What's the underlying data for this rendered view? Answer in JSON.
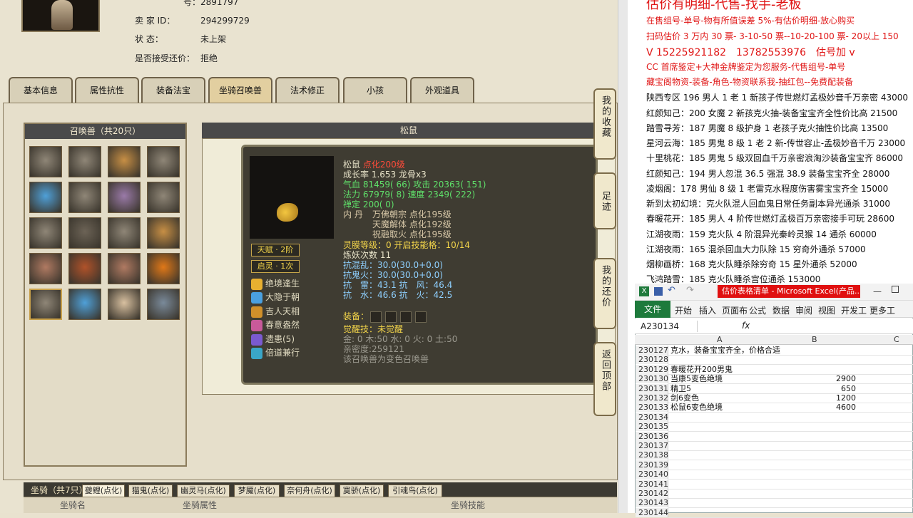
{
  "game": {
    "header": {
      "id_partial": "号：2891797",
      "seller_label": "卖 家 ID：",
      "seller_id": "294299729",
      "status_label": "状 态：",
      "status_value": "未上架",
      "bargain_label": "是否接受还价：",
      "bargain_value": "拒绝"
    },
    "tabs": [
      "基本信息",
      "属性抗性",
      "装备法宝",
      "坐骑召唤兽",
      "法术修正",
      "小孩",
      "外观道具"
    ],
    "active_tab": "坐骑召唤兽",
    "pet_panel_title": "召唤兽（共20只）",
    "detail_title": "松鼠",
    "pet": {
      "name": "松鼠",
      "dianhua": "点化200级",
      "growth": "成长率 1.653 龙骨x3",
      "hp_label": "气血",
      "hp": "81459( 66)",
      "atk_label": "攻击",
      "atk": "20363( 151)",
      "mp_label": "法力",
      "mp": "67979( 8)",
      "spd_label": "速度",
      "spd": "2349( 222)",
      "chan": "禅定 200( 0)",
      "neidan_label": "内 丹",
      "neidan": [
        "万佛朝宗 点化195级",
        "天魔解体 点化192级",
        "祝融取火 点化195级"
      ],
      "spirit": "灵膜等级：0 开启技能格：10/14",
      "refine": "炼妖次数 11",
      "res1": "抗混乱：30.0(30.0+0.0)",
      "res2": "抗鬼火：30.0(30.0+0.0)",
      "res3": "抗　雷：43.1 抗　风：46.4",
      "res4": "抗　水：46.6 抗　火：42.5",
      "equip_label": "装备：",
      "awaken": "觉醒技：未觉醒",
      "elements": "金: 0 木:50 水: 0 火: 0 土:50",
      "intimacy": "亲密度:259121",
      "note": "该召唤兽为变色召唤兽",
      "badges": [
        "天赋 · 2阶",
        "启灵 · 1次"
      ],
      "skills": [
        "绝境逢生",
        "大隐于朝",
        "吉人天相",
        "春意盎然",
        "遗患(5)",
        "倍道兼行"
      ]
    },
    "side_nav": [
      "我的收藏",
      "足迹",
      "我的还价",
      "返回顶部"
    ],
    "mount_label": "坐骑（共7只）",
    "mount_tabs": [
      "夔鲤(点化)",
      "猫鬼(点化)",
      "幽灵马(点化)",
      "梦魇(点化)",
      "奈何舟(点化)",
      "寞骄(点化)",
      "引魂鸟(点化)"
    ],
    "mount_headers": [
      "坐骑名",
      "坐骑属性",
      "坐骑技能"
    ]
  },
  "right_panel": {
    "title_partial": "估价有明细-代售-找手-老板",
    "red_lines": [
      "在售组号-单号-物有所值误差 5%-有估价明细-放心购买",
      "扫码估价 3 万内 30 票- 3-10-50 票--10-20-100 票- 20以上 150",
      "V 15225921182　13782553976　估号加 v",
      "CC 首席鉴定+大神金牌鉴定为您服务-代售组号-单号",
      "藏宝阁物资-装备-角色-物资联系我-抽红包--免费配装备"
    ],
    "listings": [
      "陕西专区 196 男人 1 老 1 新孩子传世燃灯孟极妙音千万亲密 43000",
      "红颜知己：200 女魔 2 新孩克火抽-装备宝宝齐全性价比高 21500",
      "踏雪寻芳：187 男魔 8 级护身 1 老孩子克火抽性价比高 13500",
      "星河云海：185 男鬼 8 级 1 老 2 新-传世容止-孟极妙音千万 23000",
      "十里桃花：185 男鬼 5 级双回血千万亲密浪淘沙装备宝宝齐 86000",
      "红颜知己：194 男人忽混 36.5 强混 38.9 装备宝宝齐全 28000",
      "凌烟阁：178 男仙 8 级 1 老雷克水程度伤害雾宝宝齐全 15000",
      "新到太初幻境：克火队混人回血鬼日常任务副本异光通杀 31000",
      "春暖花开：185 男人 4 阶传世燃灯孟极百万亲密接手可玩 28600",
      "江湖夜雨：159 克火队 4 阶混异光秦岭灵猴 14 通杀 60000",
      "江湖夜雨：165 混杀回血大力队除 15 穷奇外通杀 57000",
      "烟柳画桥：168 克火队睡杀除穷奇 15 星外通杀 52000",
      "飞鸿踏雪：185 克火队睡杀宫位通杀 153000"
    ]
  },
  "excel": {
    "title": "估价表格清单 - Microsoft Excel(产品...",
    "ribbon": [
      "文件",
      "开始",
      "插入",
      "页面布",
      "公式",
      "数据",
      "审阅",
      "视图",
      "开发工",
      "更多工"
    ],
    "name_box": "A230134",
    "fx": "fx",
    "col_headers": [
      "A",
      "B",
      "C"
    ],
    "rows": [
      {
        "n": "230127",
        "a": "克水，装备宝宝齐全，价格合适",
        "b": ""
      },
      {
        "n": "230128",
        "a": "",
        "b": ""
      },
      {
        "n": "230129",
        "a": "春暖花开200男鬼",
        "b": ""
      },
      {
        "n": "230130",
        "a": "当康5变色绝境",
        "b": "2900"
      },
      {
        "n": "230131",
        "a": "精卫5",
        "b": "650"
      },
      {
        "n": "230132",
        "a": "剑6变色",
        "b": "1200"
      },
      {
        "n": "230133",
        "a": "松鼠6变色绝境",
        "b": "4600"
      },
      {
        "n": "230134",
        "a": "",
        "b": ""
      },
      {
        "n": "230135",
        "a": "",
        "b": ""
      },
      {
        "n": "230136",
        "a": "",
        "b": ""
      },
      {
        "n": "230137",
        "a": "",
        "b": ""
      },
      {
        "n": "230138",
        "a": "",
        "b": ""
      },
      {
        "n": "230139",
        "a": "",
        "b": ""
      },
      {
        "n": "230140",
        "a": "",
        "b": ""
      },
      {
        "n": "230141",
        "a": "",
        "b": ""
      },
      {
        "n": "230142",
        "a": "",
        "b": ""
      },
      {
        "n": "230143",
        "a": "",
        "b": ""
      },
      {
        "n": "230144",
        "a": "",
        "b": ""
      }
    ]
  }
}
